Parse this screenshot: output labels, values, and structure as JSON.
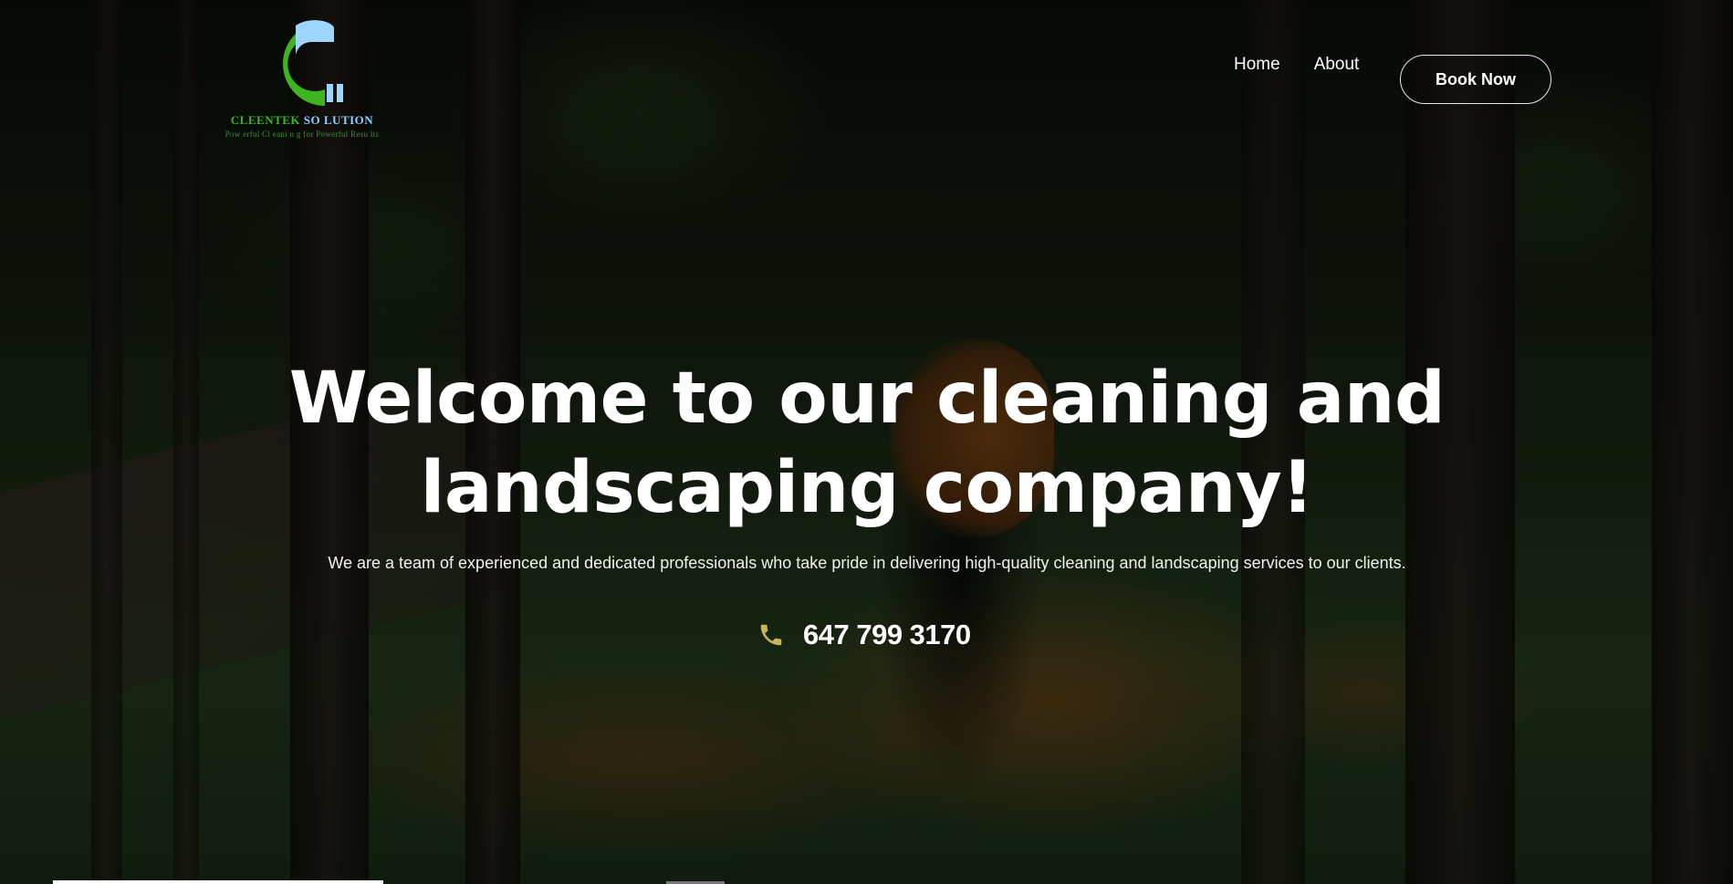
{
  "brand": {
    "name_part1": "CLEENTEK",
    "name_part2": "SO LUTION",
    "tagline": "Pow erful Cl eani n g for Powerful Resu lts",
    "colors": {
      "green": "#3cb521",
      "light_blue": "#8fd0ff"
    }
  },
  "nav": {
    "home_label": "Home",
    "about_label": "About",
    "book_label": "Book Now"
  },
  "hero": {
    "title_line1": "Welcome to our cleaning and",
    "title_line2": "landscaping company!",
    "subtitle": "We are a team of experienced and dedicated professionals who take pride in delivering high-quality cleaning and landscaping services to our clients.",
    "phone": "647 799 3170",
    "phone_icon": "phone-icon",
    "phone_icon_color": "#c8b45a"
  }
}
